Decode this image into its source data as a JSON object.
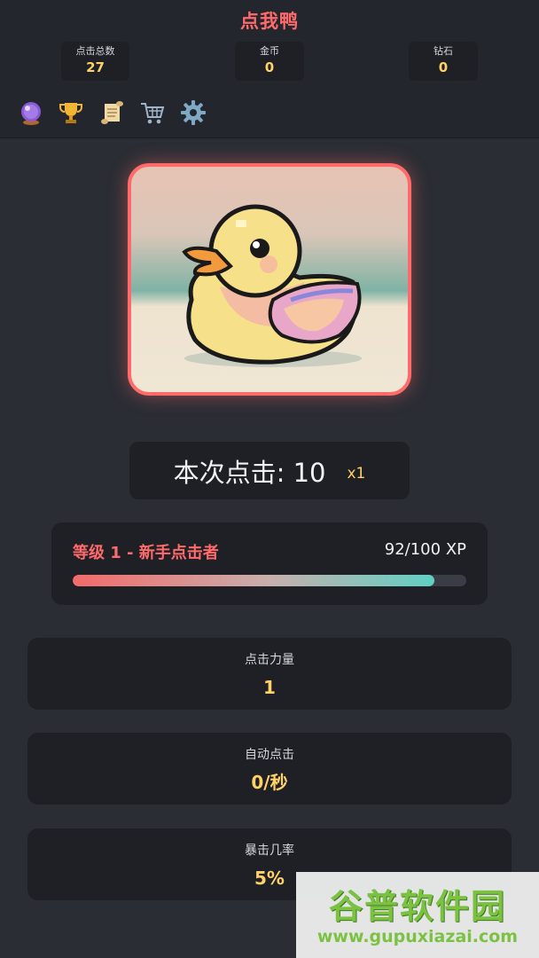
{
  "header": {
    "title": "点我鸭",
    "stats": {
      "total_clicks_label": "点击总数",
      "total_clicks_value": "27",
      "coins_label": "金币",
      "coins_value": "0",
      "gems_label": "钻石",
      "gems_value": "0"
    },
    "toolbar": [
      "crystal-ball-icon",
      "trophy-icon",
      "scroll-icon",
      "shopping-cart-icon",
      "gear-icon"
    ]
  },
  "clicker": {
    "image_subject": "pixel-art yellow duck",
    "current_clicks_text": "本次点击: 10",
    "multiplier": "x1"
  },
  "level": {
    "name": "等级 1 - 新手点击者",
    "xp_text": "92/100 XP",
    "progress": 0.92
  },
  "stats_panels": [
    {
      "label": "点击力量",
      "value": "1"
    },
    {
      "label": "自动点击",
      "value": "0/秒"
    },
    {
      "label": "暴击几率",
      "value": "5%"
    }
  ],
  "watermark": {
    "title": "谷普软件园",
    "url": "www.gupuxiazai.com"
  },
  "colors": {
    "background": "#2a2d34",
    "card": "#1e2025",
    "accent_red": "#ff6b6b",
    "accent_gold": "#ffd166",
    "xp_teal": "#5fd0c4"
  }
}
